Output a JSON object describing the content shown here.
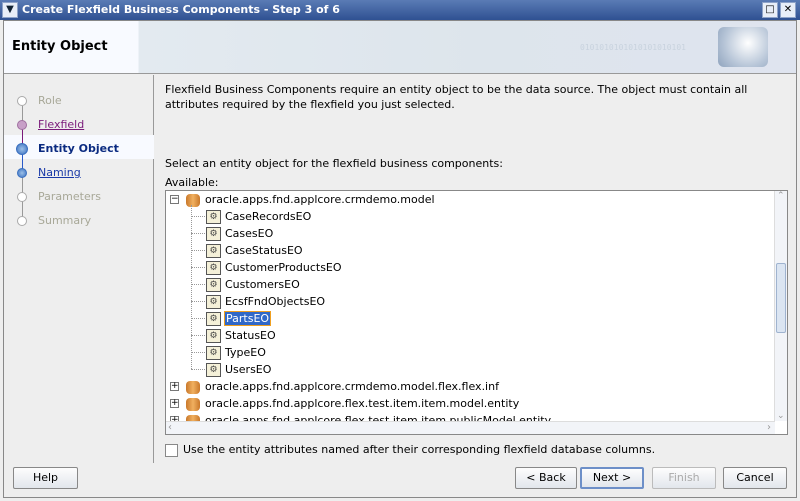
{
  "window": {
    "title": "Create Flexfield Business Components - Step 3 of 6",
    "menu_icon": "chevron-down-icon",
    "maximize_icon": "maximize-icon",
    "close_icon": "close-icon"
  },
  "header": {
    "title": "Entity Object",
    "binary_decor": "0101010101010101010101"
  },
  "steps": [
    {
      "label": "Role",
      "state": "disabled"
    },
    {
      "label": "Flexfield",
      "state": "visited"
    },
    {
      "label": "Entity Object",
      "state": "current"
    },
    {
      "label": "Naming",
      "state": "link"
    },
    {
      "label": "Parameters",
      "state": "disabled"
    },
    {
      "label": "Summary",
      "state": "disabled"
    }
  ],
  "content": {
    "intro": "Flexfield Business Components require an entity object to be the data source. The object must contain all attributes required by the flexfield you just selected.",
    "prompt": "Select an entity object for the flexfield business components:",
    "available_label": "Available:",
    "tree": {
      "root": "oracle.apps.fnd.applcore.crmdemo.model",
      "children": [
        "CaseRecordsEO",
        "CasesEO",
        "CaseStatusEO",
        "CustomerProductsEO",
        "CustomersEO",
        "EcsfFndObjectsEO",
        "PartsEO",
        "StatusEO",
        "TypeEO",
        "UsersEO"
      ],
      "selected": "PartsEO",
      "collapsed": [
        "oracle.apps.fnd.applcore.crmdemo.model.flex.flex.inf",
        "oracle.apps.fnd.applcore.flex.test.item.item.model.entity",
        "oracle.apps.fnd.applcore.flex.test.item.item.publicModel.entity"
      ]
    },
    "checkbox_label": "Use the entity attributes named after their corresponding flexfield database columns.",
    "checkbox_checked": false
  },
  "buttons": {
    "help": "Help",
    "back": "< Back",
    "next": "Next >",
    "finish": "Finish",
    "cancel": "Cancel"
  },
  "colors": {
    "titlebar": "#2f5192",
    "selection": "#3068c8",
    "current_step": "#0a2a80",
    "visited": "#7a1a7a",
    "link": "#1a3aa8"
  }
}
